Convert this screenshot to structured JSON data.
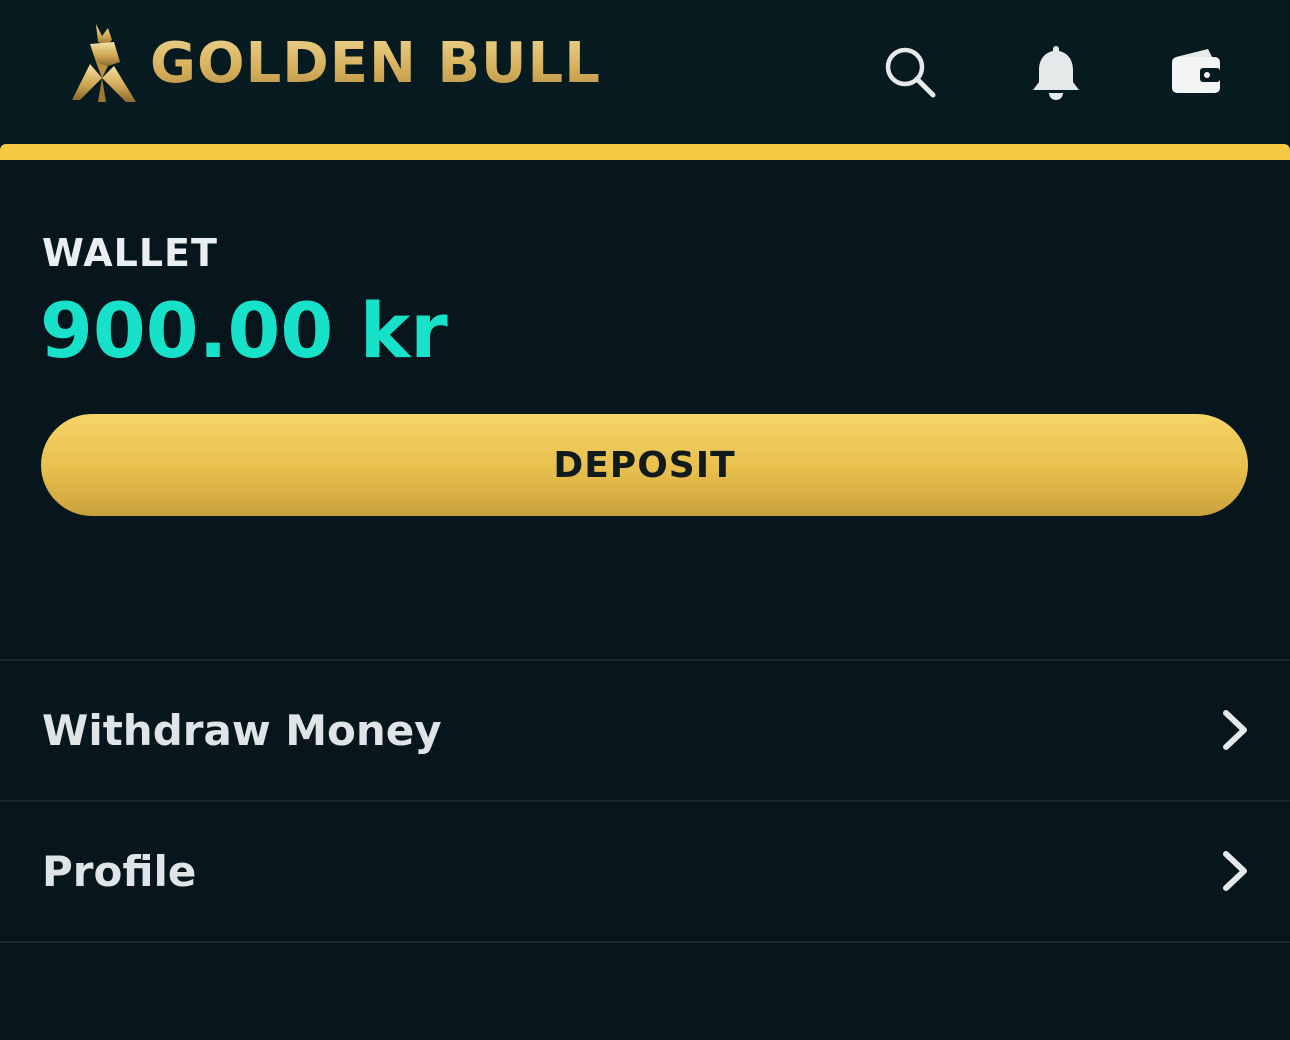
{
  "brand": {
    "name": "GOLDEN BULL"
  },
  "header": {
    "icons": [
      "search-icon",
      "bell-icon",
      "wallet-icon"
    ]
  },
  "wallet": {
    "label": "WALLET",
    "balance": "900.00 kr"
  },
  "deposit_button": {
    "label": "DEPOSIT"
  },
  "menu": {
    "items": [
      {
        "label": "Withdraw Money"
      },
      {
        "label": "Profile"
      }
    ]
  },
  "colors": {
    "background": "#06161c",
    "accent_gold": "#f6c945",
    "balance_teal": "#17e1c9"
  }
}
